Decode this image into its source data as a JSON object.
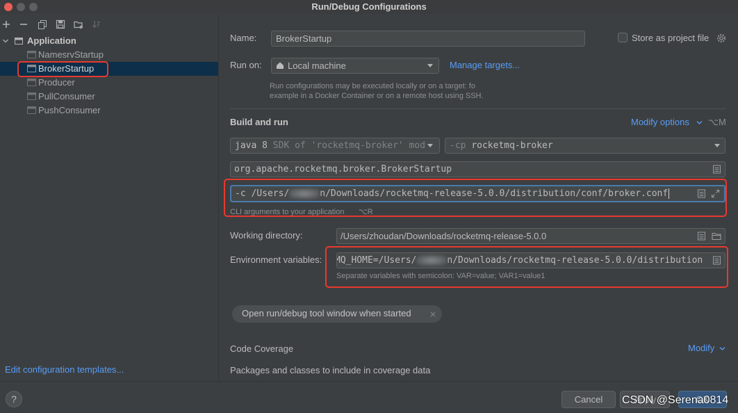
{
  "window": {
    "title": "Run/Debug Configurations",
    "controls": [
      "close-window-button",
      "minimize-window-button",
      "zoom-window-button"
    ]
  },
  "toolbar": {
    "icons": [
      "add-icon",
      "remove-icon",
      "copy-icon",
      "save-icon",
      "new-folder-icon",
      "sort-icon"
    ]
  },
  "tree": {
    "group": "Application",
    "group_icon": "application-config-icon",
    "item_icon": "run-config-icon",
    "items": [
      {
        "label": "NamesrvStartup",
        "selected": false
      },
      {
        "label": "BrokerStartup",
        "selected": true,
        "highlighted": true
      },
      {
        "label": "Producer",
        "selected": false
      },
      {
        "label": "PullConsumer",
        "selected": false
      },
      {
        "label": "PushConsumer",
        "selected": false
      }
    ],
    "edit_templates_link": "Edit configuration templates..."
  },
  "form": {
    "name": {
      "label": "Name:",
      "value": "BrokerStartup"
    },
    "store_as_project_file": {
      "label": "Store as project file",
      "checked": false,
      "icon": "gear-icon"
    },
    "run_on": {
      "label": "Run on:",
      "value": "Local machine",
      "icon": "house-icon",
      "manage_link": "Manage targets...",
      "hint_line1": "Run configurations may be executed locally or on a target: fo",
      "hint_line2": "example in a Docker Container or on a remote host using SSH."
    },
    "build_and_run": {
      "title": "Build and run",
      "modify_options": "Modify options",
      "modify_options_shortcut": "⌥M",
      "sdk": {
        "version": "java 8",
        "description": "SDK of 'rocketmq-broker' mod"
      },
      "classpath": {
        "flag": "-cp",
        "module": "rocketmq-broker"
      },
      "main_class": "org.apache.rocketmq.broker.BrokerStartup",
      "program_arguments": {
        "prefix": "-c /Users/",
        "suffix": "n/Downloads/rocketmq-release-5.0.0/distribution/conf/broker.conf",
        "redacted": true,
        "focused": true,
        "highlighted": true,
        "hint": "CLI arguments to your application",
        "hint_shortcut": "⌥R"
      }
    },
    "working_directory": {
      "label": "Working directory:",
      "value": "/Users/zhoudan/Downloads/rocketmq-release-5.0.0"
    },
    "environment_variables": {
      "label": "Environment variables:",
      "prefix": "MQ_HOME=/Users/",
      "suffix": "n/Downloads/rocketmq-release-5.0.0/distribution",
      "redacted": true,
      "highlighted": true,
      "hint": "Separate variables with semicolon: VAR=value; VAR1=value1"
    },
    "tool_window_option": "Open run/debug tool window when started",
    "code_coverage": {
      "title": "Code Coverage",
      "modify_link": "Modify",
      "packages_label": "Packages and classes to include in coverage data"
    }
  },
  "footer": {
    "help": "?",
    "cancel": "Cancel",
    "apply": "Apply",
    "ok": "OK"
  },
  "watermark": "CSDN @Serena0814",
  "colors": {
    "background": "#3c3f41",
    "selection": "#0d2f4a",
    "link": "#589df6",
    "annotation": "#e8392f",
    "focus_border": "#4a7bab",
    "ok_button": "#365880",
    "close_light": "#ec5f57"
  }
}
